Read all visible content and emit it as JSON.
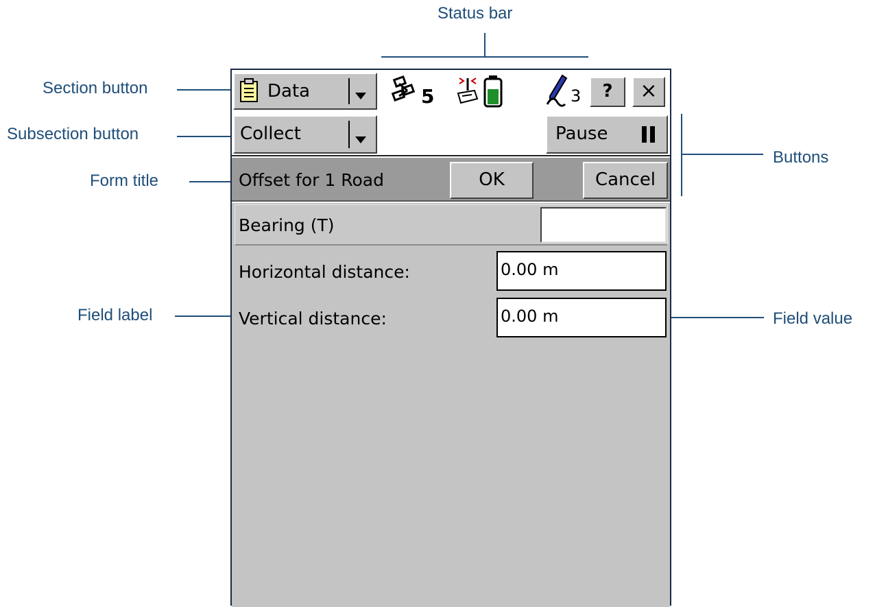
{
  "callouts": {
    "status_bar": "Status bar",
    "section_button": "Section button",
    "subsection_button": "Subsection button",
    "form_title": "Form title",
    "buttons": "Buttons",
    "field_label": "Field label",
    "field_value": "Field value"
  },
  "status_bar": {
    "section_label": "Data",
    "satellite_count": "5",
    "pen_count": "3",
    "help_label": "?",
    "close_label": "×"
  },
  "subsection": {
    "label": "Collect",
    "pause_label": "Pause"
  },
  "form": {
    "title": "Offset for 1 Road",
    "ok_label": "OK",
    "cancel_label": "Cancel"
  },
  "fields": [
    {
      "label": "Bearing (T)",
      "value": ""
    },
    {
      "label": "Horizontal distance:",
      "value": "0.00 m"
    },
    {
      "label": "Vertical distance:",
      "value": "0.00 m"
    }
  ],
  "colors": {
    "callout_text": "#1f4e79",
    "panel_gray": "#c4c4c4",
    "title_bar_gray": "#9a9a9a",
    "battery_green": "#1f8f2a"
  },
  "icons": [
    "clipboard-icon",
    "satellite-icon",
    "radio-icon",
    "battery-icon",
    "pen-icon",
    "pause-icon",
    "dropdown-arrow-icon"
  ]
}
